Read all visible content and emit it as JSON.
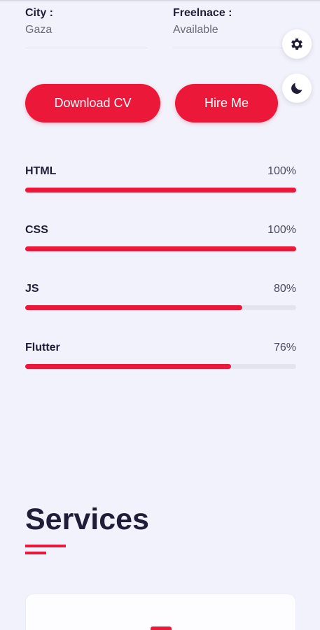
{
  "info": {
    "city_label": "City :",
    "city_value": "Gaza",
    "freelance_label": "Freelnace :",
    "freelance_value": "Available"
  },
  "buttons": {
    "download_cv": "Download CV",
    "hire_me": "Hire Me"
  },
  "floating": {
    "settings_icon": "gear-icon",
    "theme_icon": "moon-icon"
  },
  "skills": [
    {
      "name": "HTML",
      "percent_label": "100%",
      "percent": 100
    },
    {
      "name": "CSS",
      "percent_label": "100%",
      "percent": 100
    },
    {
      "name": "JS",
      "percent_label": "80%",
      "percent": 80
    },
    {
      "name": "Flutter",
      "percent_label": "76%",
      "percent": 76
    }
  ],
  "services": {
    "title": "Services"
  },
  "colors": {
    "accent": "#ec1839",
    "background": "#f2f2fc",
    "text_dark": "#1f1d38"
  }
}
